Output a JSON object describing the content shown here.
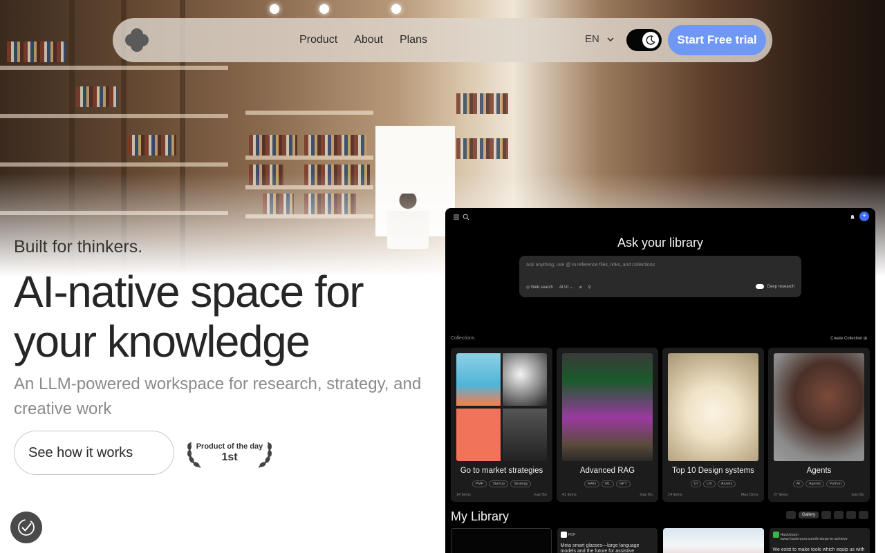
{
  "nav": {
    "links": [
      "Product",
      "About",
      "Plans"
    ],
    "language": "EN",
    "theme_mode": "dark",
    "cta_label": "Start Free trial",
    "cta_color": "#6f97f4"
  },
  "hero": {
    "eyebrow": "Built for thinkers.",
    "headline_line1": "AI-native space for",
    "headline_line2": "your knowledge",
    "subtitle": "An LLM-powered workspace for research, strategy, and creative work",
    "secondary_cta": "See how it works",
    "award_line1": "Product of the day",
    "award_line2": "1st"
  },
  "app_preview": {
    "ask_title": "Ask your library",
    "ask_placeholder": "Ask anything, use @ to reference files, links, and collections",
    "ask_tools": [
      "Web search",
      "AI UI"
    ],
    "deep_research_label": "Deep research",
    "collections_label": "Collections",
    "create_collection_label": "Create Collection",
    "collections": [
      {
        "title": "Go to market strategies",
        "tags": [
          "PMF",
          "Startup",
          "Strategy"
        ],
        "count": "14 items",
        "owner": "Ivan Bo"
      },
      {
        "title": "Advanced RAG",
        "tags": [
          "RAG",
          "ML",
          "GPT"
        ],
        "count": "41 items",
        "owner": "Ivan Bo"
      },
      {
        "title": "Top 10 Design systems",
        "tags": [
          "UI",
          "UX",
          "Assets"
        ],
        "count": "14 items",
        "owner": "Max Orlov"
      },
      {
        "title": "Agents",
        "tags": [
          "AI",
          "Agents",
          "Python"
        ],
        "count": "27 items",
        "owner": "Ivan Bo"
      }
    ],
    "my_library_label": "My Library",
    "view_gallery_label": "Gallery",
    "library_items": [
      {
        "label": "",
        "text": ""
      },
      {
        "label": "PDF",
        "text": "Meta smart glasses—large language models and the future for assistive"
      },
      {
        "label": "",
        "text": ""
      },
      {
        "label": "Hackmoon",
        "text": "We exist to make tools which equip us with knowledge, deeper understanding"
      }
    ],
    "library_item3_url": "www.hackmoon.com/b-steps-to-achieve"
  }
}
